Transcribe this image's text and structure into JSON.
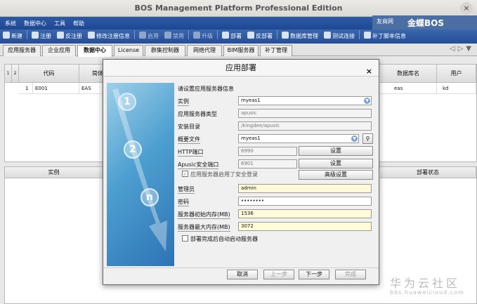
{
  "window": {
    "title": "BOS Management Platform Professional Edition",
    "close": "×"
  },
  "brand": {
    "logo_text": "友商网",
    "name": "金蝶BOS"
  },
  "menu": [
    "系统",
    "数据中心",
    "工具",
    "帮助"
  ],
  "toolbar": [
    {
      "label": "新建",
      "enabled": true
    },
    {
      "label": "注册",
      "enabled": true
    },
    {
      "label": "反注册",
      "enabled": true
    },
    {
      "label": "修改注册信息",
      "enabled": true
    },
    {
      "label": "启用",
      "enabled": false
    },
    {
      "label": "禁用",
      "enabled": false
    },
    {
      "label": "升级",
      "enabled": false
    },
    {
      "label": "部署",
      "enabled": true
    },
    {
      "label": "反部署",
      "enabled": true
    },
    {
      "label": "数据库管理",
      "enabled": true
    },
    {
      "label": "测试连接",
      "enabled": true
    },
    {
      "label": "补丁脚本信息",
      "enabled": true
    }
  ],
  "tabs": [
    "应用服务器",
    "企业应用",
    "数据中心",
    "License",
    "群集控制器",
    "网络代理",
    "BIM服务器",
    "补丁管理"
  ],
  "active_tab": 2,
  "tab_nav": {
    "left": "◁",
    "right": "▷",
    "menu": "▼"
  },
  "grid_top": {
    "row_marks": [
      "1",
      "2"
    ],
    "headers": [
      "代码",
      "简体",
      "数据库名",
      "用户"
    ],
    "row": {
      "num": "1",
      "code": "E001",
      "name": "EAS",
      "db": "eas",
      "user": "kd"
    }
  },
  "grid_bottom": {
    "headers": [
      "实例",
      "部署状态"
    ]
  },
  "watermark": {
    "line1": "华为云社区",
    "line2": "bbs.huaweicloud.com"
  },
  "dialog": {
    "title": "应用部署",
    "close": "×",
    "steps": [
      "1",
      "2",
      "n"
    ],
    "prompt": "请设置应用服务器信息",
    "fields": {
      "instance": {
        "label": "实例",
        "value": "myeas1"
      },
      "server_type": {
        "label": "应用服务器类型",
        "value": "apusic"
      },
      "install_dir": {
        "label": "安装目录",
        "value": "/kingdee/apusic"
      },
      "profile": {
        "label": "概要文件",
        "value": "myeas1"
      },
      "http_port": {
        "label": "HTTP端口",
        "value": "6990",
        "button": "设置"
      },
      "ssl_port": {
        "label": "Apusic安全端口",
        "value": "6901",
        "button": "设置"
      },
      "ssl_login": {
        "label": "应用服务器启用了安全登录",
        "checked": true,
        "button": "高级设置"
      },
      "admin": {
        "label": "管理员",
        "value": "admin"
      },
      "password": {
        "label": "密码",
        "value": "••••••••"
      },
      "min_mem": {
        "label": "服务器初始内存(MB)",
        "value": "1536"
      },
      "max_mem": {
        "label": "服务器最大内存(MB)",
        "value": "3072"
      },
      "autostart": {
        "label": "部署完成后自动启动服务器",
        "checked": false
      }
    },
    "buttons": {
      "cancel": "取消",
      "prev": "上一步",
      "next": "下一步",
      "finish": "完成"
    }
  }
}
